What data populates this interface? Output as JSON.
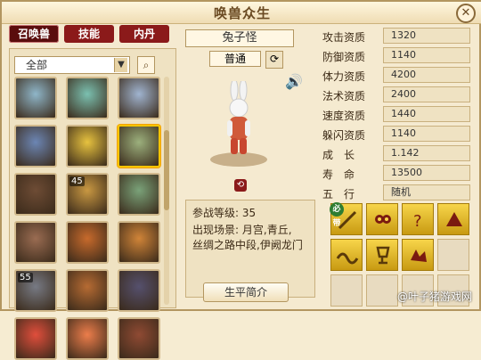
{
  "window": {
    "title": "唤兽众生",
    "close_icon": "close-icon"
  },
  "tabs": [
    {
      "label": "召唤兽",
      "active": true
    },
    {
      "label": "技能",
      "active": false
    },
    {
      "label": "内丹",
      "active": false
    }
  ],
  "filter": {
    "value": "全部"
  },
  "pet_grid": {
    "cells": [
      {
        "level": "",
        "color": "#8fb6c9"
      },
      {
        "level": "",
        "color": "#7bc0b0"
      },
      {
        "level": "",
        "color": "#a0b4d0"
      },
      {
        "level": "",
        "color": "#6c86b4"
      },
      {
        "level": "",
        "color": "#e7c23f"
      },
      {
        "level": "",
        "color": "#9cb07d"
      },
      {
        "level": "",
        "color": "#6e4c35"
      },
      {
        "level": "45",
        "color": "#c99842"
      },
      {
        "level": "",
        "color": "#7aa279"
      },
      {
        "level": "",
        "color": "#9a6c52"
      },
      {
        "level": "",
        "color": "#c76a2c"
      },
      {
        "level": "",
        "color": "#d08438"
      },
      {
        "level": "55",
        "color": "#777a84"
      },
      {
        "level": "",
        "color": "#b66b33"
      },
      {
        "level": "",
        "color": "#55506d"
      },
      {
        "level": "",
        "color": "#e04e3c"
      },
      {
        "level": "",
        "color": "#ec7d4b"
      },
      {
        "level": "",
        "color": "#8f4a33"
      }
    ],
    "selected_index": 5
  },
  "pet": {
    "name": "兔子怪",
    "type": "普通",
    "info": {
      "level_label": "参战等级:",
      "level_value": "35",
      "location_label": "出现场景:",
      "location_line1": "月宫,青丘,",
      "location_line2": "丝绸之路中段,伊阙龙门"
    },
    "bio_button": "生平简介"
  },
  "stats": [
    {
      "label": "攻击资质",
      "value": "1320"
    },
    {
      "label": "防御资质",
      "value": "1140"
    },
    {
      "label": "体力资质",
      "value": "4200"
    },
    {
      "label": "法术资质",
      "value": "2400"
    },
    {
      "label": "速度资质",
      "value": "1440"
    },
    {
      "label": "躲闪资质",
      "value": "1140"
    },
    {
      "label": "成　长",
      "value": "1.142"
    },
    {
      "label": "寿　命",
      "value": "13500"
    },
    {
      "label": "五　行",
      "value": "随机"
    }
  ],
  "skills": [
    {
      "filled": true,
      "badge": "必带",
      "icon": "feather-icon"
    },
    {
      "filled": true,
      "badge": "",
      "icon": "owl-icon"
    },
    {
      "filled": true,
      "badge": "",
      "icon": "question-icon"
    },
    {
      "filled": true,
      "badge": "",
      "icon": "beast-icon"
    },
    {
      "filled": true,
      "badge": "",
      "icon": "wave-icon"
    },
    {
      "filled": true,
      "badge": "",
      "icon": "cup-icon"
    },
    {
      "filled": true,
      "badge": "",
      "icon": "hand-icon"
    },
    {
      "filled": false,
      "badge": "",
      "icon": ""
    },
    {
      "filled": false,
      "badge": "",
      "icon": ""
    },
    {
      "filled": false,
      "badge": "",
      "icon": ""
    },
    {
      "filled": false,
      "badge": "",
      "icon": ""
    },
    {
      "filled": false,
      "badge": "",
      "icon": ""
    }
  ],
  "watermark": "@叶子猪游戏网"
}
